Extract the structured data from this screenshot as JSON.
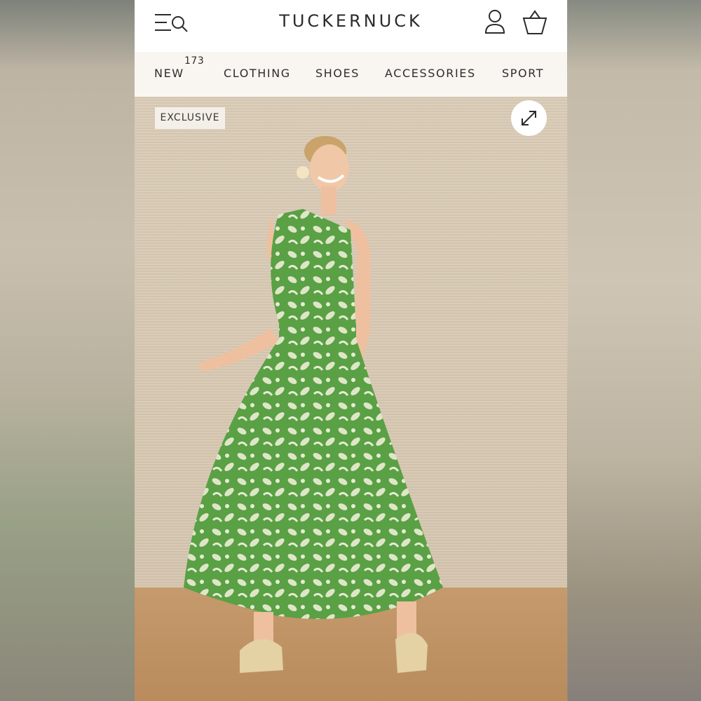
{
  "header": {
    "brand": "TUCKERNUCK",
    "menu_icon": "menu-search-icon",
    "account_icon": "account-icon",
    "bag_icon": "shopping-bag-icon"
  },
  "nav": {
    "items": [
      {
        "label": "NEW",
        "badge": "173"
      },
      {
        "label": "CLOTHING"
      },
      {
        "label": "SHOES"
      },
      {
        "label": "ACCESSORIES"
      },
      {
        "label": "SPORT"
      }
    ]
  },
  "product_image": {
    "badge": "EXCLUSIVE",
    "expand_icon": "expand-icon",
    "colors": {
      "dress_green": "#5aa045",
      "dress_print": "#dfe6c8",
      "wall": "#d6c7b1",
      "floor": "#bd8f61"
    }
  }
}
